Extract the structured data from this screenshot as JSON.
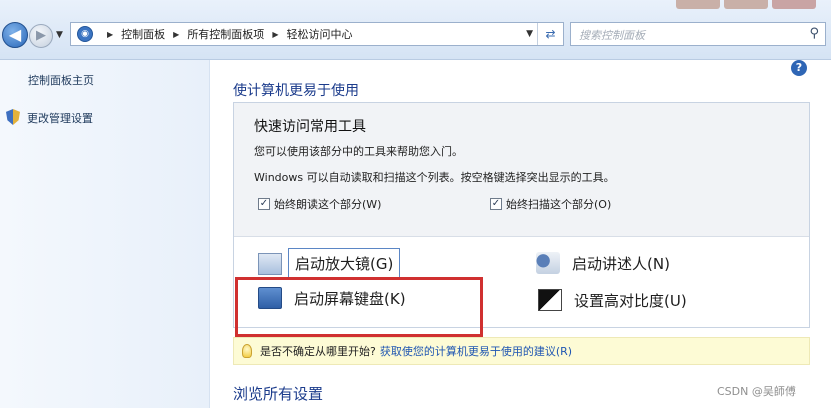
{
  "breadcrumb": [
    "控制面板",
    "所有控制面板项",
    "轻松访问中心"
  ],
  "search": {
    "placeholder": "搜索控制面板"
  },
  "sidebar": {
    "home_link": "控制面板主页",
    "admin_link": "更改管理设置"
  },
  "main": {
    "heading": "使计算机更易于使用",
    "quick_tools": {
      "title": "快速访问常用工具",
      "desc1": "您可以使用该部分中的工具来帮助您入门。",
      "desc2": "Windows 可以自动读取和扫描这个列表。按空格键选择突出显示的工具。",
      "checkbox_read": {
        "label": "始终朗读这个部分(W)",
        "checked": true
      },
      "checkbox_scan": {
        "label": "始终扫描这个部分(O)",
        "checked": true
      },
      "tools": {
        "magnifier": "启动放大镜(G)",
        "narrator": "启动讲述人(N)",
        "keyboard": "启动屏幕键盘(K)",
        "contrast": "设置高对比度(U)"
      }
    },
    "tip": {
      "question": "是否不确定从哪里开始?",
      "link": "获取使您的计算机更易于使用的建议(R)"
    },
    "browse_heading": "浏览所有设置"
  },
  "watermark": "CSDN @吴師傅",
  "colors": {
    "heading": "#1c3c8c",
    "link": "#1f56b2",
    "highlight_border": "#d03030"
  }
}
